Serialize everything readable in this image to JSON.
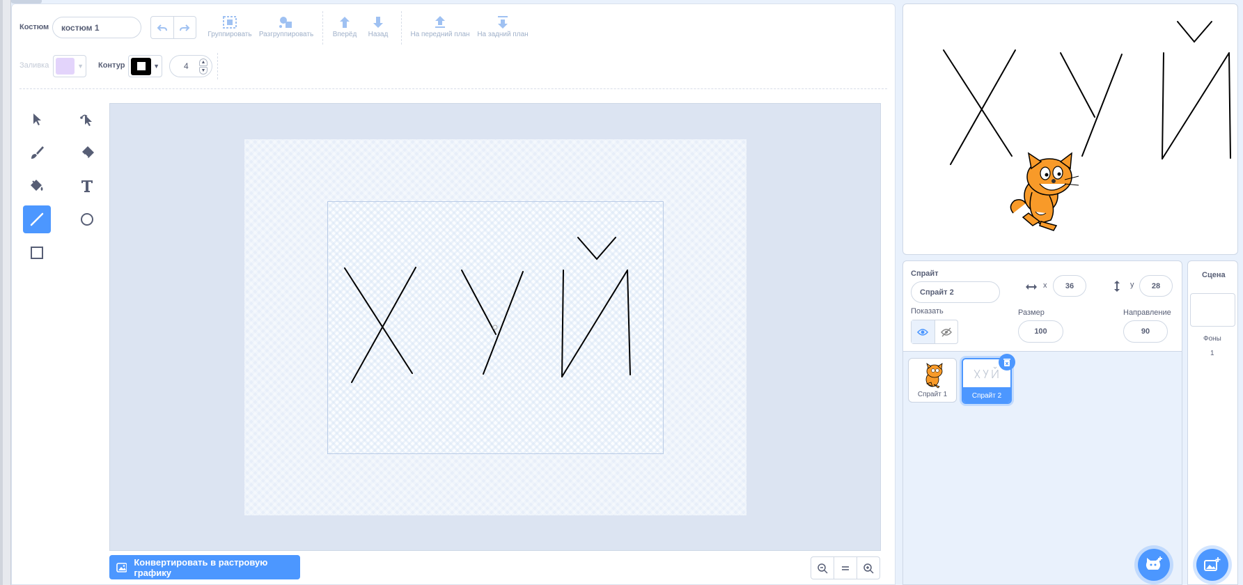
{
  "costume": {
    "label": "Костюм",
    "name_value": "костюм 1"
  },
  "toolbar": {
    "group": "Группировать",
    "ungroup": "Разгруппировать",
    "forward": "Вперёд",
    "backward": "Назад",
    "front": "На передний план",
    "back": "На задний план"
  },
  "style": {
    "fill_label": "Заливка",
    "fill_color": "#e3d4fb",
    "outline_label": "Контур",
    "outline_color": "#000000",
    "outline_width": "4"
  },
  "tools": [
    "select-tool",
    "reshape-tool",
    "brush-tool",
    "eraser-tool",
    "fill-tool",
    "text-tool",
    "line-tool",
    "circle-tool",
    "rectangle-tool"
  ],
  "selected_tool": "line-tool",
  "canvas": {
    "convert_button": "Конвертировать в растровую графику"
  },
  "sprite": {
    "label": "Спрайт",
    "name": "Спрайт 2",
    "x_label": "x",
    "x": "36",
    "y_label": "y",
    "y": "28",
    "show_label": "Показать",
    "size_label": "Размер",
    "size": "100",
    "direction_label": "Направление",
    "direction": "90"
  },
  "sprites": [
    {
      "name": "Спрайт 1",
      "selected": false
    },
    {
      "name": "Спрайт 2",
      "selected": true
    }
  ],
  "stage_panel": {
    "title": "Сцена",
    "backdrops_label": "Фоны",
    "backdrops_count": "1"
  },
  "colors": {
    "accent": "#4c97ff",
    "text": "#575e75",
    "muted": "#9fb0c9"
  }
}
